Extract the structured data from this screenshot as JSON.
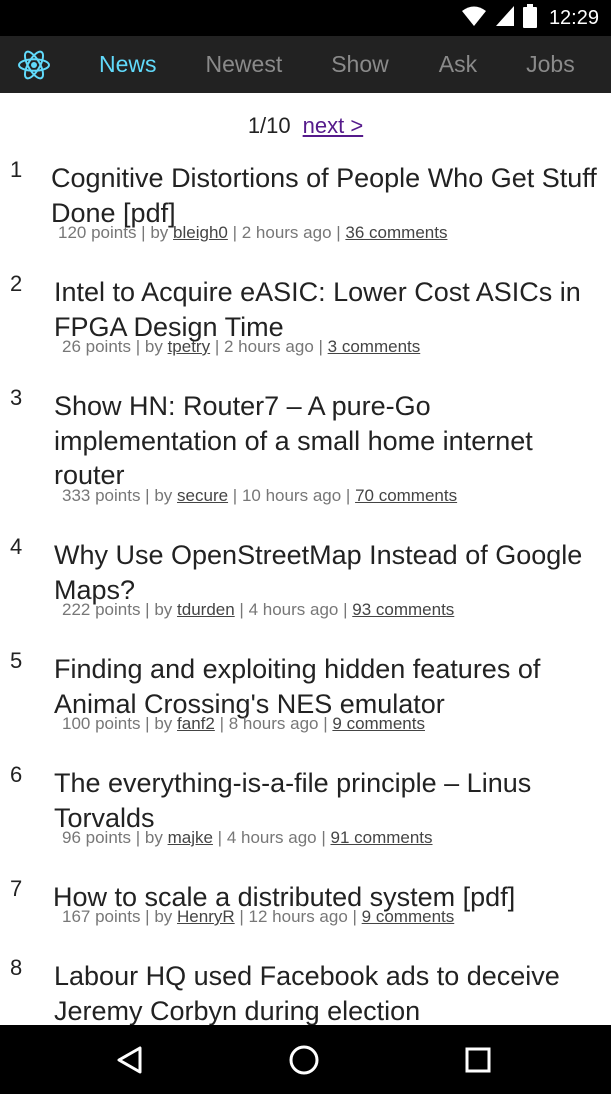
{
  "status_bar": {
    "time": "12:29"
  },
  "nav": {
    "tabs": [
      {
        "label": "News",
        "active": true
      },
      {
        "label": "Newest",
        "active": false
      },
      {
        "label": "Show",
        "active": false
      },
      {
        "label": "Ask",
        "active": false
      },
      {
        "label": "Jobs",
        "active": false
      }
    ],
    "accent_color": "#61dafb",
    "bar_color": "#222222"
  },
  "pager": {
    "page": "1/10",
    "next_label": "next >"
  },
  "stories": [
    {
      "rank": "1",
      "title": "Cognitive Distortions of People Who Get Stuff Done [pdf]",
      "points": "120 points",
      "by": "by",
      "author": "bleigh0",
      "age": "2 hours ago",
      "comments": "36 comments"
    },
    {
      "rank": "2",
      "title": "Intel to Acquire eASIC: Lower Cost ASICs in FPGA Design Time",
      "points": "26 points",
      "by": "by",
      "author": "tpetry",
      "age": "2 hours ago",
      "comments": "3 comments"
    },
    {
      "rank": "3",
      "title": "Show HN: Router7 – A pure-Go implementation of a small home internet router",
      "points": "333 points",
      "by": "by",
      "author": "secure",
      "age": "10 hours ago",
      "comments": "70 comments"
    },
    {
      "rank": "4",
      "title": "Why Use OpenStreetMap Instead of Google Maps?",
      "points": "222 points",
      "by": "by",
      "author": "tdurden",
      "age": "4 hours ago",
      "comments": "93 comments"
    },
    {
      "rank": "5",
      "title": "Finding and exploiting hidden features of Animal Crossing's NES emulator",
      "points": "100 points",
      "by": "by",
      "author": "fanf2",
      "age": "8 hours ago",
      "comments": "9 comments"
    },
    {
      "rank": "6",
      "title": "The everything-is-a-file principle – Linus Torvalds",
      "points": "96 points",
      "by": "by",
      "author": "majke",
      "age": "4 hours ago",
      "comments": "91 comments"
    },
    {
      "rank": "7",
      "title": "How to scale a distributed system [pdf]",
      "points": "167 points",
      "by": "by",
      "author": "HenryR",
      "age": "12 hours ago",
      "comments": "9 comments"
    },
    {
      "rank": "8",
      "title": "Labour HQ used Facebook ads to deceive Jeremy Corbyn during election",
      "points": "",
      "by": "",
      "author": "",
      "age": "",
      "comments": ""
    }
  ],
  "icons": {
    "logo": "react-atom-icon",
    "status": [
      "wifi-icon",
      "signal-icon",
      "battery-icon"
    ],
    "system_nav": [
      "back-icon",
      "home-icon",
      "recents-icon"
    ]
  }
}
